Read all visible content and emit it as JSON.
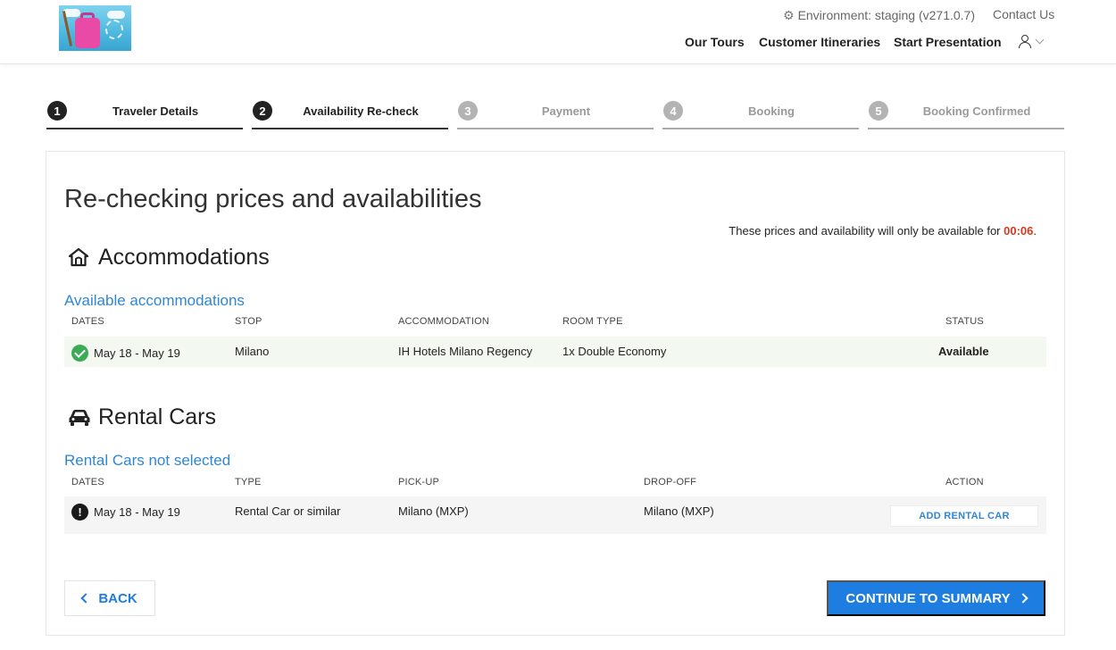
{
  "header": {
    "environment": "Environment: staging (v271.0.7)",
    "contact": "Contact Us",
    "nav": [
      "Our Tours",
      "Customer Itineraries",
      "Start Presentation"
    ]
  },
  "steps": [
    {
      "num": "1",
      "label": "Traveler Details",
      "active": true
    },
    {
      "num": "2",
      "label": "Availability Re-check",
      "active": true
    },
    {
      "num": "3",
      "label": "Payment",
      "active": false
    },
    {
      "num": "4",
      "label": "Booking",
      "active": false
    },
    {
      "num": "5",
      "label": "Booking Confirmed",
      "active": false
    }
  ],
  "page": {
    "title": "Re-checking prices and availabilities",
    "timer_text": "These prices and availability will only be available for ",
    "timer_value": "00:06",
    "timer_suffix": "."
  },
  "accommodations": {
    "title": "Accommodations",
    "subtitle": "Available accommodations",
    "columns": [
      "DATES",
      "STOP",
      "ACCOMMODATION",
      "ROOM TYPE",
      "STATUS"
    ],
    "row": {
      "dates": "May 18 - May 19",
      "stop": "Milano",
      "accommodation": "IH Hotels Milano Regency",
      "room_type": "1x Double Economy",
      "status": "Available"
    }
  },
  "rental_cars": {
    "title": "Rental Cars",
    "subtitle": "Rental Cars not selected",
    "columns": [
      "DATES",
      "TYPE",
      "PICK-UP",
      "DROP-OFF",
      "ACTION"
    ],
    "row": {
      "dates": "May 18 - May 19",
      "type": "Rental Car or similar",
      "pickup": "Milano (MXP)",
      "dropoff": "Milano (MXP)",
      "action": "ADD RENTAL CAR"
    }
  },
  "buttons": {
    "back": "BACK",
    "continue": "CONTINUE TO SUMMARY"
  },
  "colors": {
    "accent": "#1e7de0",
    "link": "#2f86d6",
    "timer": "#d9381e",
    "available_row": "#f3f9f1",
    "success": "#3cab55"
  }
}
